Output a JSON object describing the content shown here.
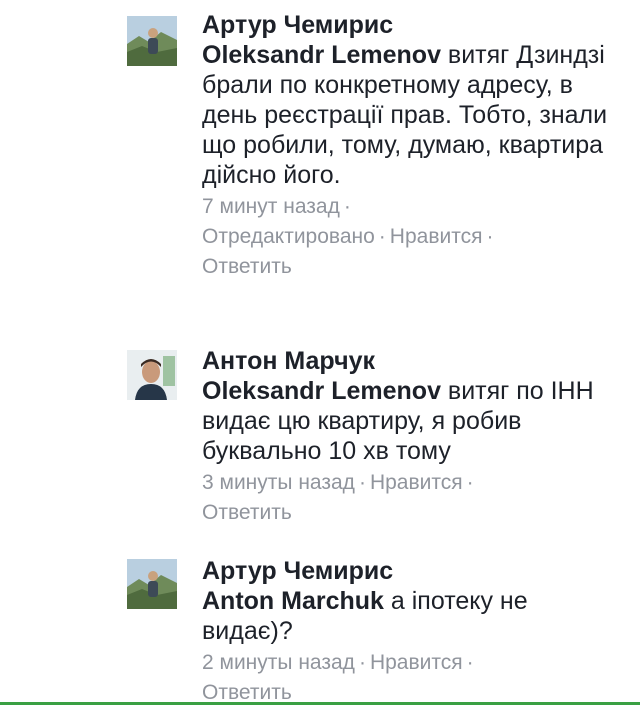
{
  "comments": [
    {
      "author": "Артур Чемирис",
      "mention": "Oleksandr Lemenov",
      "text": " витяг Дзиндзі брали по конкретному адресу, в день реєстрації прав. Тобто, знали що робили, тому, думаю, квартира дійсно його.",
      "time": "7 минут назад",
      "edited": "Отредактировано",
      "like": "Нравится",
      "reply": "Ответить",
      "separator": "·"
    },
    {
      "author": "Антон Марчук",
      "mention": "Oleksandr Lemenov",
      "text": " витяг по ІНН видає цю квартиру, я робив буквально 10 хв тому",
      "time": "3 минуты назад",
      "like": "Нравится",
      "reply": "Ответить",
      "separator": "·"
    },
    {
      "author": "Артур Чемирис",
      "mention": "Anton Marchuk",
      "text": " а іпотеку не видає)?",
      "time": "2 минуты назад",
      "like": "Нравится",
      "reply": "Ответить",
      "separator": "·"
    }
  ]
}
